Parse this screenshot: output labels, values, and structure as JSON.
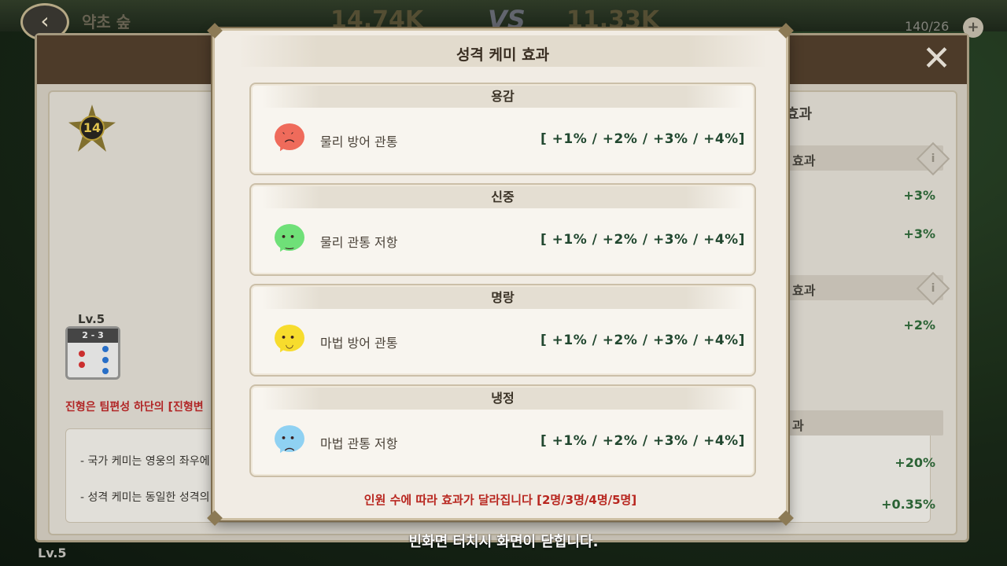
{
  "background": {
    "title": "약초 숲",
    "score_left": "14.74K",
    "vs": "VS",
    "score_right": "11.33K",
    "count": "140/26",
    "badge_level": "14",
    "formation_level": "Lv.5",
    "formation_code": "2 - 3",
    "formation_note": "진형은 팀편성 하단의 [진형변",
    "info_lines": [
      "- 국가 케미는 영웅의 좌우에",
      "- 성격 케미는 동일한 성격의"
    ],
    "right_panel": {
      "heading": "효과",
      "section1": "효과",
      "values1": [
        "+3%",
        "+3%"
      ],
      "section2": "효과",
      "values2": [
        "+2%"
      ],
      "section3": "과",
      "values3": [
        "+20%",
        "+0.35%"
      ]
    },
    "bottom_level": "Lv.5"
  },
  "modal": {
    "title": "성격 케미 효과",
    "cards": [
      {
        "name": "용감",
        "effect": "물리 방어 관통",
        "values": "[ +1% / +2% / +3% / +4%]",
        "emoji": "angry",
        "color": "#ef6b5b"
      },
      {
        "name": "신중",
        "effect": "물리 관통 저항",
        "values": "[ +1% / +2% / +3% / +4%]",
        "emoji": "calm",
        "color": "#6fe078"
      },
      {
        "name": "명랑",
        "effect": "마법 방어 관통",
        "values": "[ +1% / +2% / +3% / +4%]",
        "emoji": "happy",
        "color": "#f7dc2d"
      },
      {
        "name": "냉정",
        "effect": "마법 관통 저항",
        "values": "[ +1% / +2% / +3% / +4%]",
        "emoji": "cold",
        "color": "#8fd1f2"
      }
    ],
    "note": "인원 수에 따라 효과가 달라집니다 [2명/3명/4명/5명]"
  },
  "close_hint": "빈화면 터치시 화면이 닫힙니다."
}
